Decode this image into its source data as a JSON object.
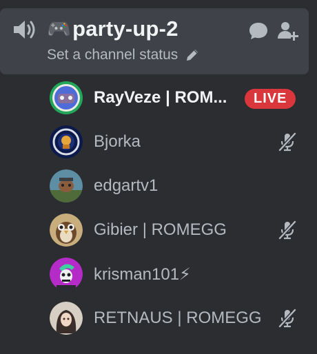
{
  "channel": {
    "emoji": "🎮",
    "name": "party-up-2",
    "status_placeholder": "Set a channel status"
  },
  "members": [
    {
      "name": "RayVeze | ROM...",
      "badge": "LIVE",
      "muted": false,
      "speaking": true
    },
    {
      "name": "Bjorka",
      "badge": "",
      "muted": true,
      "speaking": false
    },
    {
      "name": "edgartv1",
      "badge": "",
      "muted": false,
      "speaking": false
    },
    {
      "name": "Gibier | ROMEGG",
      "badge": "",
      "muted": true,
      "speaking": false
    },
    {
      "name": "krisman101⚡",
      "badge": "",
      "muted": false,
      "speaking": false
    },
    {
      "name": "RETNAUS | ROMEGG",
      "badge": "",
      "muted": true,
      "speaking": false
    }
  ],
  "colors": {
    "background": "#2b2d31",
    "selected": "#404249",
    "live": "#da373c",
    "speaking": "#23a55a",
    "muted_text": "#b5bac1",
    "icon": "#b5bac1"
  },
  "icons": {
    "channel": "speaker-icon",
    "status_edit": "pencil-icon",
    "chat": "chat-bubble-icon",
    "invite": "add-user-icon",
    "mute": "microphone-muted-icon"
  }
}
